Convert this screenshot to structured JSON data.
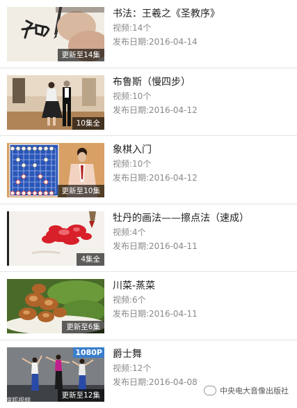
{
  "items": [
    {
      "title": "书法：王羲之《圣教序》",
      "count": "视频:14个",
      "date": "发布日期:2016-04-14",
      "badge": "更新至14集",
      "thumb": "calligraphy-brush"
    },
    {
      "title": "布鲁斯（慢四步）",
      "count": "视频:10个",
      "date": "发布日期:2016-04-12",
      "badge": "10集全",
      "thumb": "dance-couple"
    },
    {
      "title": "象棋入门",
      "count": "视频:10个",
      "date": "发布日期:2016-04-12",
      "badge": "更新至10集",
      "thumb": "chinese-chess"
    },
    {
      "title": "牡丹的画法——擦点法（速成）",
      "count": "视频:4个",
      "date": "发布日期:2016-04-11",
      "badge": "4集全",
      "thumb": "peony-painting"
    },
    {
      "title": "川菜-蒸菜",
      "count": "视频:6个",
      "date": "发布日期:2016-04-11",
      "badge": "更新至6集",
      "thumb": "steamed-dish"
    },
    {
      "title": "爵士舞",
      "count": "视频:12个",
      "date": "发布日期:2016-04-08",
      "badge": "更新至12集",
      "hd": "1080P",
      "thumb": "jazz-dancers"
    }
  ],
  "watermark": {
    "left": "搜狐视频",
    "right": "中央电大音像出版社",
    "icon": "wechat-icon"
  }
}
